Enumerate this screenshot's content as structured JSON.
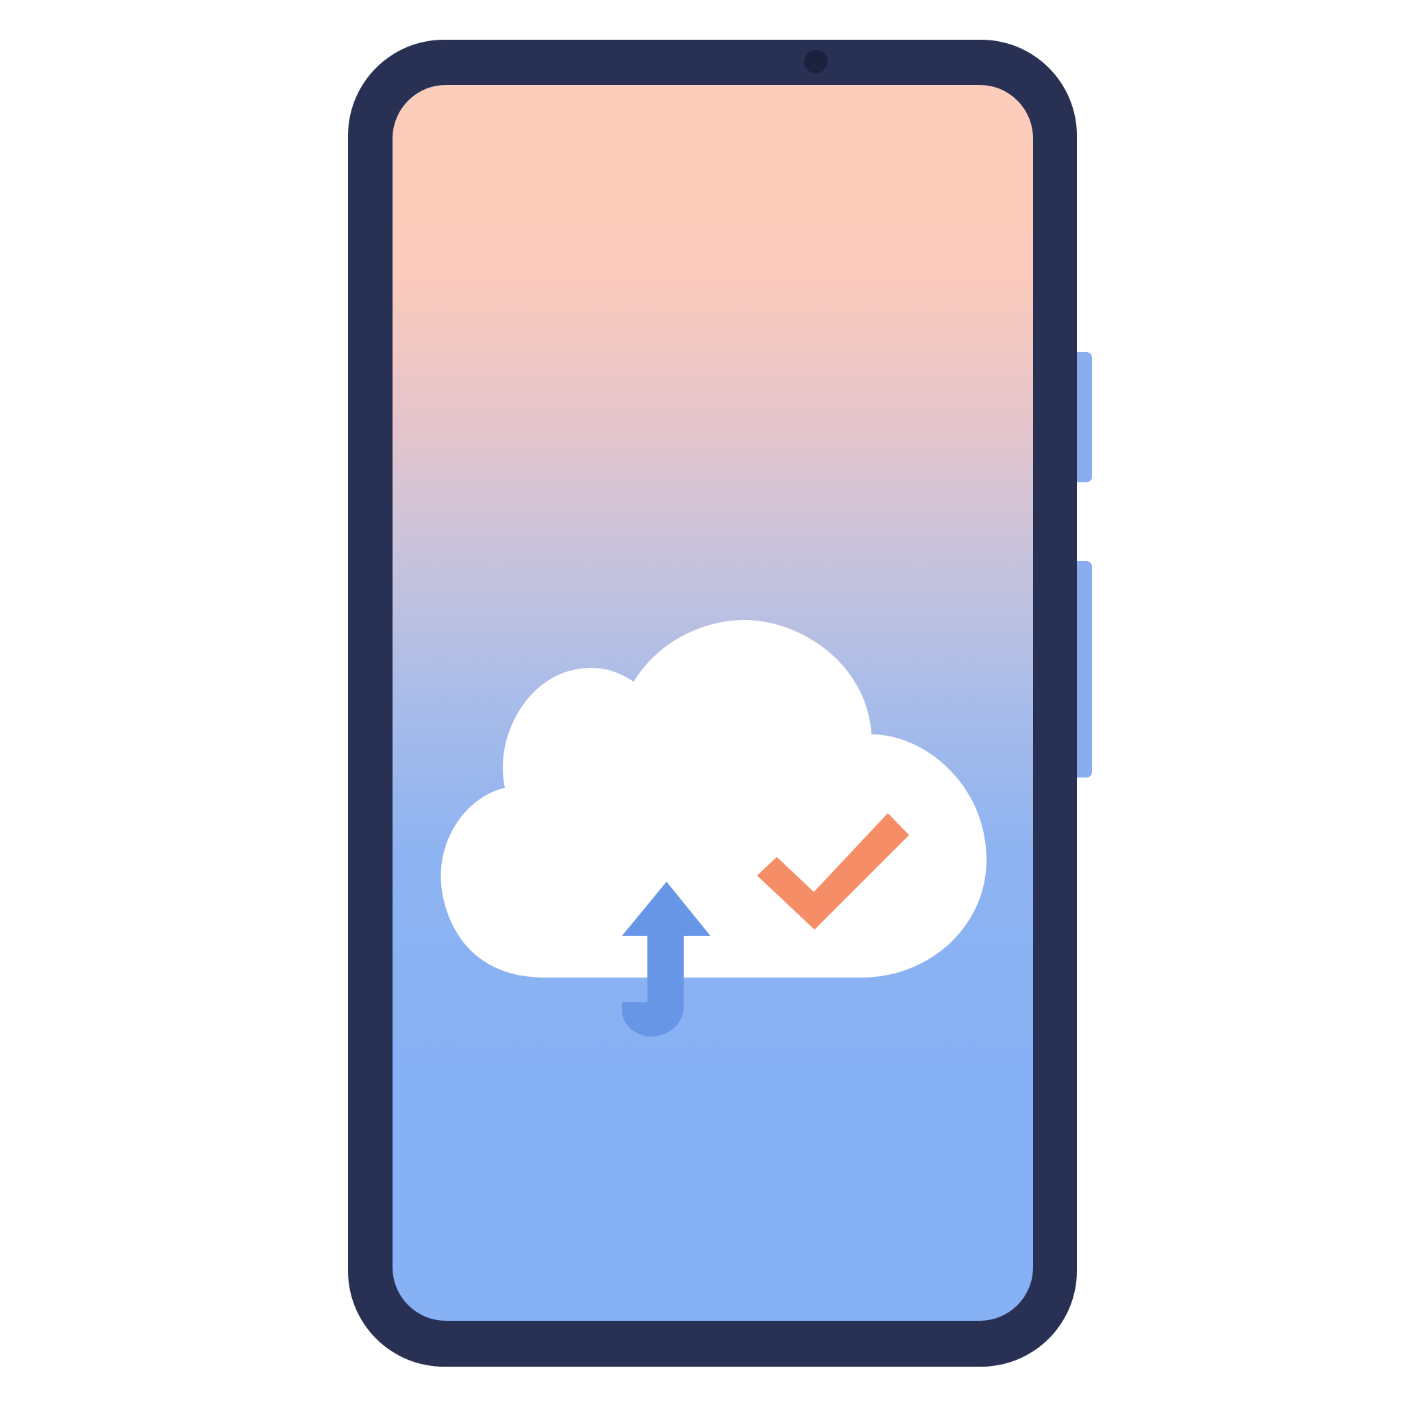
{
  "device": {
    "type": "smartphone",
    "frame_color": "#283054",
    "button_color": "#89aef0",
    "screen_gradient": [
      "#fccdbb",
      "#c8c3dc",
      "#86b1f5"
    ]
  },
  "screen": {
    "illustration": {
      "cloud_icon": "cloud-icon",
      "upload_icon": "upload-arrow-icon",
      "check_icon": "checkmark-icon",
      "cloud_color": "#ffffff",
      "arrow_color": "#6896e6",
      "check_color": "#f58d67"
    }
  }
}
